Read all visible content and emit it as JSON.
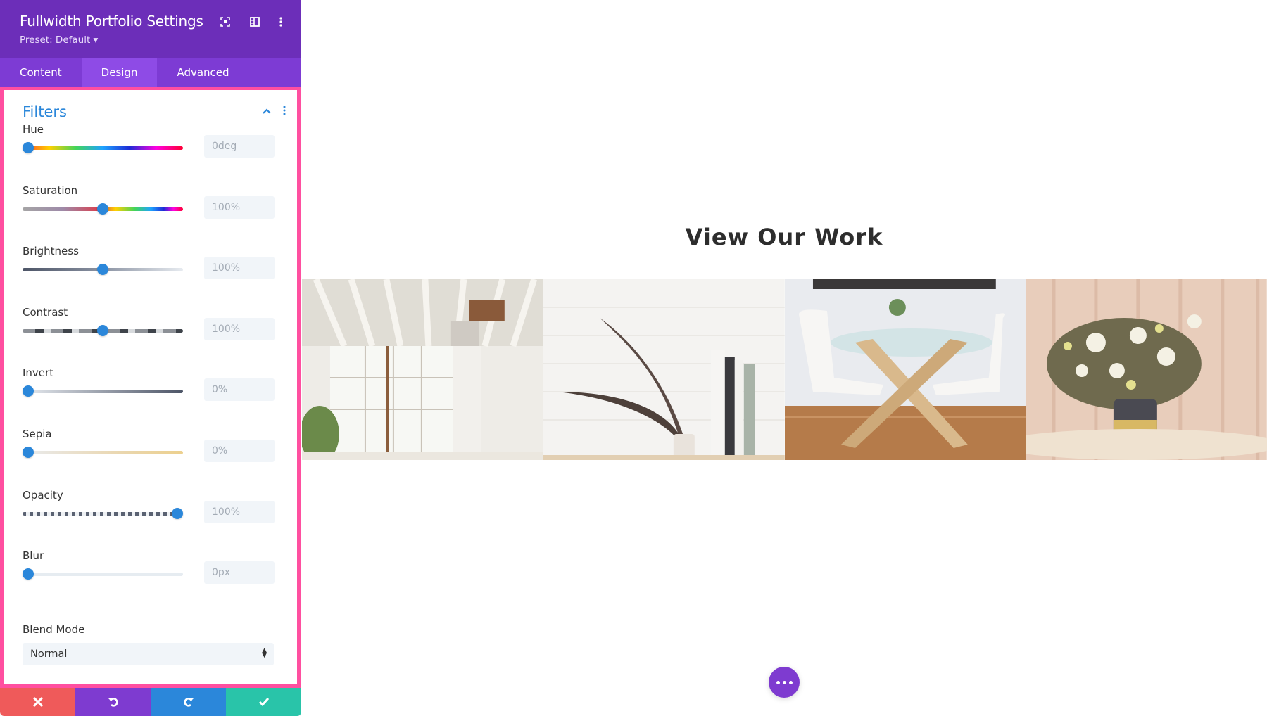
{
  "panel": {
    "title": "Fullwidth Portfolio Settings",
    "preset": "Preset: Default ▾",
    "header_icons": [
      "focus-mode-icon",
      "split-view-icon",
      "more-options-icon"
    ],
    "tabs": [
      {
        "label": "Content",
        "active": false
      },
      {
        "label": "Design",
        "active": true
      },
      {
        "label": "Advanced",
        "active": false
      }
    ],
    "section": {
      "title": "Filters",
      "expanded": true
    },
    "filters": [
      {
        "label": "Hue",
        "value": "0deg",
        "fraction": 0.0
      },
      {
        "label": "Saturation",
        "value": "100%",
        "fraction": 0.5
      },
      {
        "label": "Brightness",
        "value": "100%",
        "fraction": 0.5
      },
      {
        "label": "Contrast",
        "value": "100%",
        "fraction": 0.5
      },
      {
        "label": "Invert",
        "value": "0%",
        "fraction": 0.0
      },
      {
        "label": "Sepia",
        "value": "0%",
        "fraction": 0.0
      },
      {
        "label": "Opacity",
        "value": "100%",
        "fraction": 1.0
      },
      {
        "label": "Blur",
        "value": "0px",
        "fraction": 0.0
      }
    ],
    "blend_mode": {
      "label": "Blend Mode",
      "value": "Normal"
    },
    "footer": {
      "buttons": [
        {
          "name": "discard",
          "icon": "close-icon",
          "color": "#ef5a5a"
        },
        {
          "name": "undo",
          "icon": "undo-icon",
          "color": "#7e3bd0"
        },
        {
          "name": "redo",
          "icon": "redo-icon",
          "color": "#2b87da"
        },
        {
          "name": "save",
          "icon": "check-icon",
          "color": "#29c4a9"
        }
      ]
    }
  },
  "colors": {
    "header_bg": "#6c2eb9",
    "tabs_bg": "#7d3bd4",
    "tab_active_bg": "#8e4be6",
    "highlight_border": "#ff4fa0",
    "accent": "#2b87da"
  },
  "canvas": {
    "heading": "View Our Work",
    "portfolio_items": [
      {
        "alt": "Loft interior with white beams and large window"
      },
      {
        "alt": "Plant in speckled vase beside books on white brick"
      },
      {
        "alt": "Glass dining table with white chairs"
      },
      {
        "alt": "Wildflower bouquet in ceramic vase on marble table"
      }
    ],
    "fab_label": "more-actions"
  }
}
